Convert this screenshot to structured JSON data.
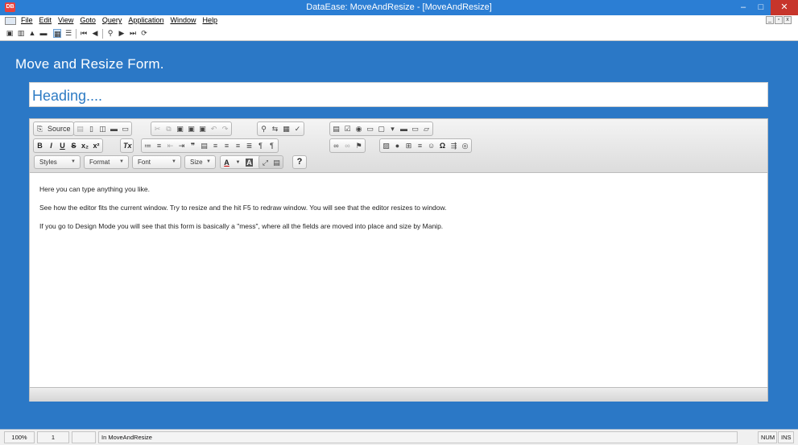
{
  "window": {
    "app_icon": "DB",
    "title": "DataEase: MoveAndResize - [MoveAndResize]",
    "minimize": "–",
    "maximize": "□",
    "close": "✕"
  },
  "menu": {
    "items": [
      "File",
      "Edit",
      "View",
      "Goto",
      "Query",
      "Application",
      "Window",
      "Help"
    ],
    "mdi_buttons": [
      "_",
      "▫",
      "x"
    ]
  },
  "form": {
    "title": "Move and Resize Form.",
    "heading": "Heading...."
  },
  "editor": {
    "toolbar_row1": {
      "source_label": "Source",
      "icons": [
        "save-icon",
        "new-page-icon",
        "preview-icon",
        "print-icon",
        "templates-icon",
        "cut-icon",
        "copy-icon",
        "paste-icon",
        "paste-text-icon",
        "paste-word-icon",
        "undo-icon",
        "redo-icon",
        "find-icon",
        "replace-icon",
        "select-all-icon",
        "spellcheck-icon",
        "form-icon",
        "checkbox-icon",
        "radio-icon",
        "textfield-icon",
        "textarea-icon",
        "select-icon",
        "button-icon",
        "imagebutton-icon",
        "hiddenfield-icon"
      ]
    },
    "toolbar_row2": {
      "bold": "B",
      "italic": "I",
      "underline": "U",
      "strike": "S",
      "subscript": "x₂",
      "superscript": "x²",
      "remove_format": "Tx"
    },
    "toolbar_row3": {
      "styles": "Styles",
      "format": "Format",
      "font": "Font",
      "size": "Size",
      "text_color": "A",
      "bg_color": "A",
      "help": "?"
    },
    "paragraphs": [
      "Here you can type anything you like.",
      "See how the editor fits the current window. Try to resize and the hit F5 to redraw window. You will see that the editor resizes to window.",
      "If you go to Design Mode you will see that this form is basically a \"mess\", where all the fields are moved into place and size by Manip."
    ]
  },
  "status": {
    "zoom": "100%",
    "record": "1",
    "blank": "",
    "location": "In MoveAndResize",
    "num": "NUM",
    "ins": "INS"
  },
  "colors": {
    "background": "#2b78c6",
    "titlebar": "#2b7ed4",
    "heading_text": "#2d7bc4",
    "close_button": "#c7352b"
  }
}
